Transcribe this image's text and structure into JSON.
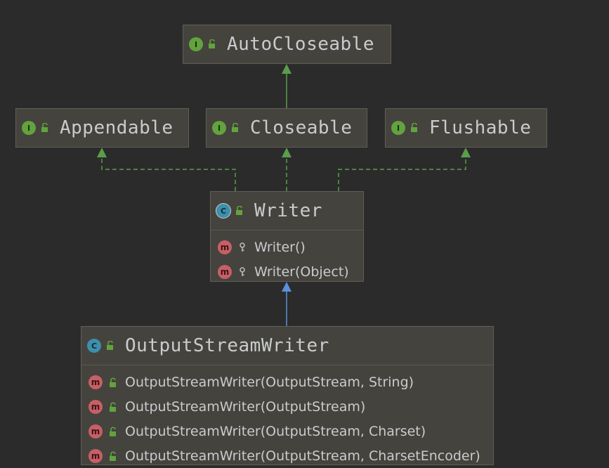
{
  "colors": {
    "background": "#2b2b2b",
    "node_fill": "#45433d",
    "interface_badge": "#62a33e",
    "class_badge": "#3d8fac",
    "method_badge": "#c75f66",
    "realization_edge": "#5a9e4a",
    "inheritance_edge": "#5b8fd9"
  },
  "badges": {
    "interface": "I",
    "class": "C",
    "method": "m"
  },
  "nodes": {
    "autocloseable": {
      "kind": "interface",
      "name": "AutoCloseable"
    },
    "appendable": {
      "kind": "interface",
      "name": "Appendable"
    },
    "closeable": {
      "kind": "interface",
      "name": "Closeable"
    },
    "flushable": {
      "kind": "interface",
      "name": "Flushable"
    },
    "writer": {
      "kind": "abstract-class",
      "name": "Writer",
      "members": [
        {
          "kind": "method",
          "visibility": "protected",
          "label": "Writer()"
        },
        {
          "kind": "method",
          "visibility": "protected",
          "label": "Writer(Object)"
        }
      ]
    },
    "outputstreamwriter": {
      "kind": "class",
      "name": "OutputStreamWriter",
      "members": [
        {
          "kind": "method",
          "visibility": "public",
          "label": "OutputStreamWriter(OutputStream, String)"
        },
        {
          "kind": "method",
          "visibility": "public",
          "label": "OutputStreamWriter(OutputStream)"
        },
        {
          "kind": "method",
          "visibility": "public",
          "label": "OutputStreamWriter(OutputStream, Charset)"
        },
        {
          "kind": "method",
          "visibility": "public",
          "label": "OutputStreamWriter(OutputStream, CharsetEncoder)"
        }
      ]
    }
  },
  "edges": [
    {
      "from": "closeable",
      "to": "autocloseable",
      "type": "extends"
    },
    {
      "from": "writer",
      "to": "appendable",
      "type": "implements"
    },
    {
      "from": "writer",
      "to": "closeable",
      "type": "implements"
    },
    {
      "from": "writer",
      "to": "flushable",
      "type": "implements"
    },
    {
      "from": "outputstreamwriter",
      "to": "writer",
      "type": "extends"
    }
  ]
}
